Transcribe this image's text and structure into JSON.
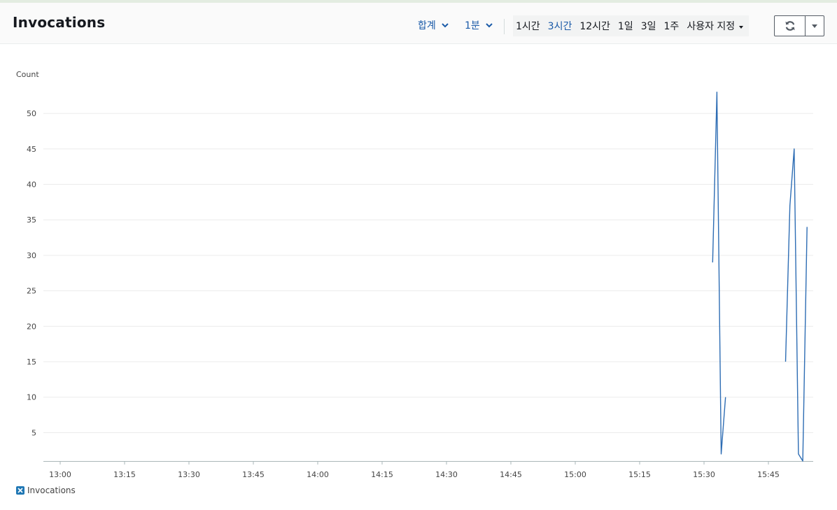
{
  "header": {
    "title": "Invocations",
    "statistic": "합계",
    "period": "1분",
    "time_ranges": [
      {
        "label": "1시간",
        "active": false
      },
      {
        "label": "3시간",
        "active": true
      },
      {
        "label": "12시간",
        "active": false
      },
      {
        "label": "1일",
        "active": false
      },
      {
        "label": "3일",
        "active": false
      },
      {
        "label": "1주",
        "active": false
      }
    ],
    "custom_label": "사용자 지정",
    "refresh_icon": "refresh-icon",
    "menu_icon": "caret-down-icon"
  },
  "colors": {
    "accent": "#1a5aa8",
    "series": "#2e6db4",
    "header_bg": "#fafafa"
  },
  "chart_data": {
    "type": "line",
    "ylabel": "Count",
    "title": "",
    "y_ticks": [
      5,
      10,
      15,
      20,
      25,
      30,
      35,
      40,
      45,
      50
    ],
    "x_ticks": [
      "13:00",
      "13:15",
      "13:30",
      "13:45",
      "14:00",
      "14:15",
      "14:30",
      "14:45",
      "15:00",
      "15:15",
      "15:30",
      "15:45"
    ],
    "xlim": [
      "12:56",
      "16:06"
    ],
    "ylim": [
      1,
      53
    ],
    "grid": true,
    "legend_position": "bottom-left",
    "series": [
      {
        "name": "Invocations",
        "segments": [
          [
            [
              "15:32",
              29
            ],
            [
              "15:33",
              53
            ],
            [
              "15:34",
              2
            ],
            [
              "15:35",
              10
            ]
          ],
          [
            [
              "15:49",
              15
            ],
            [
              "15:50",
              37
            ],
            [
              "15:51",
              45
            ],
            [
              "15:52",
              2
            ],
            [
              "15:53",
              1
            ],
            [
              "15:54",
              34
            ]
          ]
        ]
      }
    ]
  }
}
